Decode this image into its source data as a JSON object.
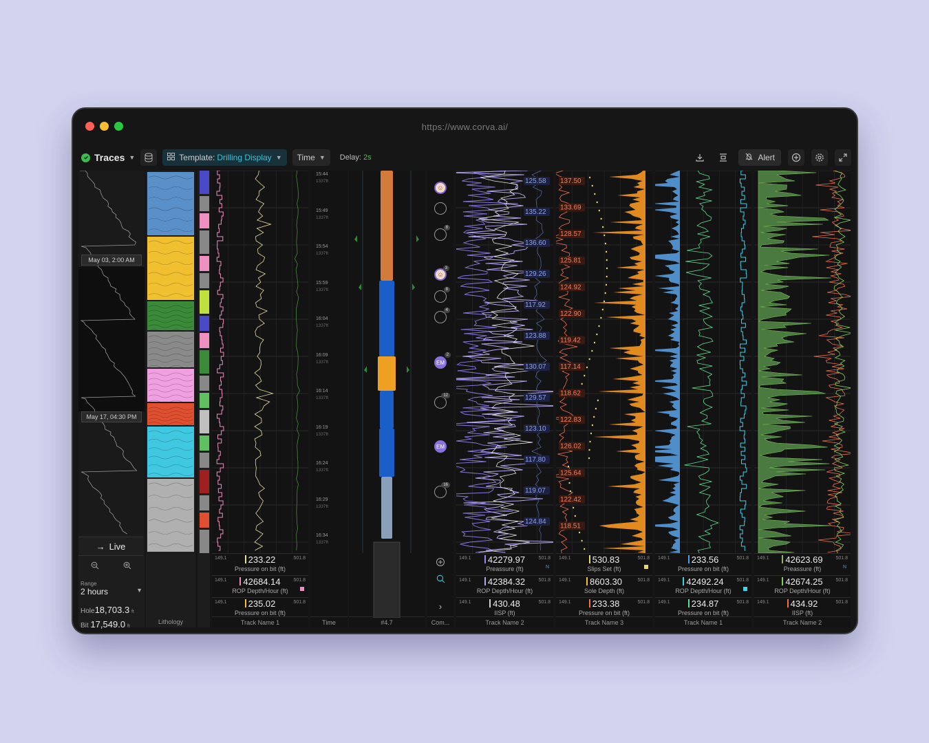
{
  "browser": {
    "url": "https://www.corva.ai/"
  },
  "toolbar": {
    "app_label": "Traces",
    "template_prefix": "Template:",
    "template_name": "Drilling Display",
    "time_label": "Time",
    "delay_label": "Delay:",
    "delay_value": "2s",
    "alert_label": "Alert",
    "icons": [
      "database-icon",
      "template-grid-icon",
      "download-icon",
      "align-icon",
      "bell-off-icon",
      "add-circle-icon",
      "gear-icon",
      "expand-icon"
    ]
  },
  "overview": {
    "stamps": [
      "May 03, 2:00 AM",
      "May 17, 04:30 PM"
    ],
    "live_label": "Live",
    "range_label": "Range",
    "range_value": "2 hours",
    "hole_label": "Hole",
    "hole_value": "18,703.3",
    "hole_unit": "ft",
    "bit_label": "Bit",
    "bit_value": "17,549.0",
    "bit_unit": "ft"
  },
  "lithology": {
    "footer": "Lithology"
  },
  "time_col": {
    "footer": "Time",
    "rows": [
      {
        "time": "15:44",
        "depth": "1337ft"
      },
      {
        "time": "15:49",
        "depth": "1337ft"
      },
      {
        "time": "15:54",
        "depth": "1337ft"
      },
      {
        "time": "15:59",
        "depth": "1337ft"
      },
      {
        "time": "16:04",
        "depth": "1337ft"
      },
      {
        "time": "16:09",
        "depth": "1337ft"
      },
      {
        "time": "16:14",
        "depth": "1337ft"
      },
      {
        "time": "16:19",
        "depth": "1337ft"
      },
      {
        "time": "16:24",
        "depth": "1337ft"
      },
      {
        "time": "16:29",
        "depth": "1337ft"
      },
      {
        "time": "16:34",
        "depth": "1337ft"
      }
    ]
  },
  "bha": {
    "footer": "#4.7"
  },
  "comments": {
    "footer": "Com...",
    "badges": [
      "8",
      "3",
      "8",
      "4",
      "2",
      "12",
      "16"
    ],
    "initials": "EM"
  },
  "tracks": [
    {
      "footer": "Track Name 1",
      "readouts": [
        {
          "min": "149.1",
          "max": "501.8",
          "value": "233.22",
          "label": "Pressure on bit (ft)",
          "color": "#e8e0a0"
        },
        {
          "min": "149.1",
          "max": "501.8",
          "value": "42684.14",
          "label": "ROP Depth/Hour (ft)",
          "color": "#ef8fbf",
          "tag": "#ef8fbf"
        },
        {
          "min": "149.1",
          "max": "501.8",
          "value": "235.02",
          "label": "Pressure on bit (ft)",
          "color": "#f2c04a"
        }
      ]
    },
    {
      "footer": "Track Name 2",
      "labels": [
        "125.58",
        "135.22",
        "136.60",
        "129.26",
        "117.92",
        "123.88",
        "130.07",
        "129.57",
        "123.10",
        "117.80",
        "119.07",
        "124.84"
      ],
      "readouts": [
        {
          "min": "149.1",
          "max": "501.8",
          "value": "42279.97",
          "label": "Preassure (ft)",
          "color": "#9b88f0",
          "n": "N"
        },
        {
          "min": "149.1",
          "max": "501.8",
          "value": "42384.32",
          "label": "ROP Depth/Hour (ft)",
          "color": "#b2a6f0"
        },
        {
          "min": "149.1",
          "max": "501.8",
          "value": "430.48",
          "label": "IISP (ft)",
          "color": "#d0d0d0"
        }
      ]
    },
    {
      "footer": "Track Name 3",
      "labels": [
        "137.50",
        "133.69",
        "128.57",
        "125.81",
        "124.92",
        "122.90",
        "119.42",
        "117.14",
        "118.62",
        "122.83",
        "126.02",
        "125.64",
        "122.42",
        "118.51"
      ],
      "readouts": [
        {
          "min": "149.1",
          "max": "501.8",
          "value": "530.83",
          "label": "Slips Set (ft)",
          "color": "#e8d870",
          "tag": "#e8d870"
        },
        {
          "min": "149.1",
          "max": "501.8",
          "value": "8603.30",
          "label": "Sole Depth (ft)",
          "color": "#f0c040"
        },
        {
          "min": "149.1",
          "max": "501.8",
          "value": "233.38",
          "label": "Pressure on bit (ft)",
          "color": "#f07050"
        }
      ]
    },
    {
      "footer": "Track Name 1",
      "readouts": [
        {
          "min": "149.1",
          "max": "501.8",
          "value": "233.56",
          "label": "Pressure on bit (ft)",
          "color": "#4fa0e8"
        },
        {
          "min": "149.1",
          "max": "501.8",
          "value": "42492.24",
          "label": "ROP Depth/Hour (ft)",
          "color": "#40d0e8",
          "tag": "#40d0e8"
        },
        {
          "min": "149.1",
          "max": "501.8",
          "value": "234.87",
          "label": "Pressure on bit (ft)",
          "color": "#60e090"
        }
      ]
    },
    {
      "footer": "Track Name 2",
      "readouts": [
        {
          "min": "149.1",
          "max": "501.8",
          "value": "42623.69",
          "label": "Preassure (ft)",
          "color": "#9ab070",
          "n": "N"
        },
        {
          "min": "149.1",
          "max": "501.8",
          "value": "42674.25",
          "label": "ROP Depth/Hour (ft)",
          "color": "#80d060"
        },
        {
          "min": "149.1",
          "max": "501.8",
          "value": "434.92",
          "label": "IISP (ft)",
          "color": "#f07050"
        }
      ]
    }
  ]
}
